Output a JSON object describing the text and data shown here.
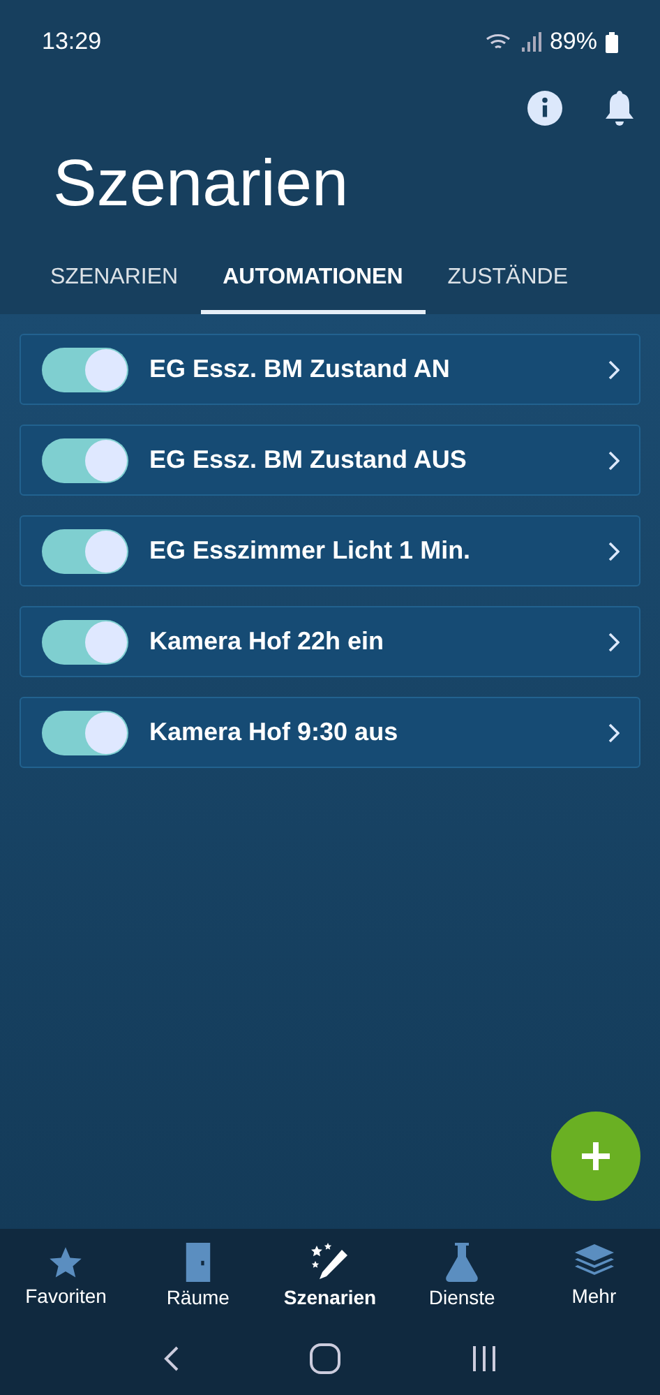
{
  "status_bar": {
    "time": "13:29",
    "battery": "89%"
  },
  "header": {
    "title": "Szenarien"
  },
  "tabs": [
    {
      "label": "SZENARIEN",
      "selected": false
    },
    {
      "label": "AUTOMATIONEN",
      "selected": true
    },
    {
      "label": "ZUSTÄNDE",
      "selected": false
    }
  ],
  "automations": [
    {
      "name": "EG Essz. BM Zustand AN",
      "on": true
    },
    {
      "name": "EG Essz. BM Zustand AUS",
      "on": true
    },
    {
      "name": "EG Esszimmer Licht 1 Min.",
      "on": true
    },
    {
      "name": "Kamera Hof 22h ein",
      "on": true
    },
    {
      "name": "Kamera Hof 9:30 aus",
      "on": true
    }
  ],
  "bottom_nav": [
    {
      "label": "Favoriten",
      "kind": "star",
      "selected": false
    },
    {
      "label": "Räume",
      "kind": "door",
      "selected": false
    },
    {
      "label": "Szenarien",
      "kind": "wand",
      "selected": true
    },
    {
      "label": "Dienste",
      "kind": "flask",
      "selected": false
    },
    {
      "label": "Mehr",
      "kind": "layers",
      "selected": false
    }
  ]
}
